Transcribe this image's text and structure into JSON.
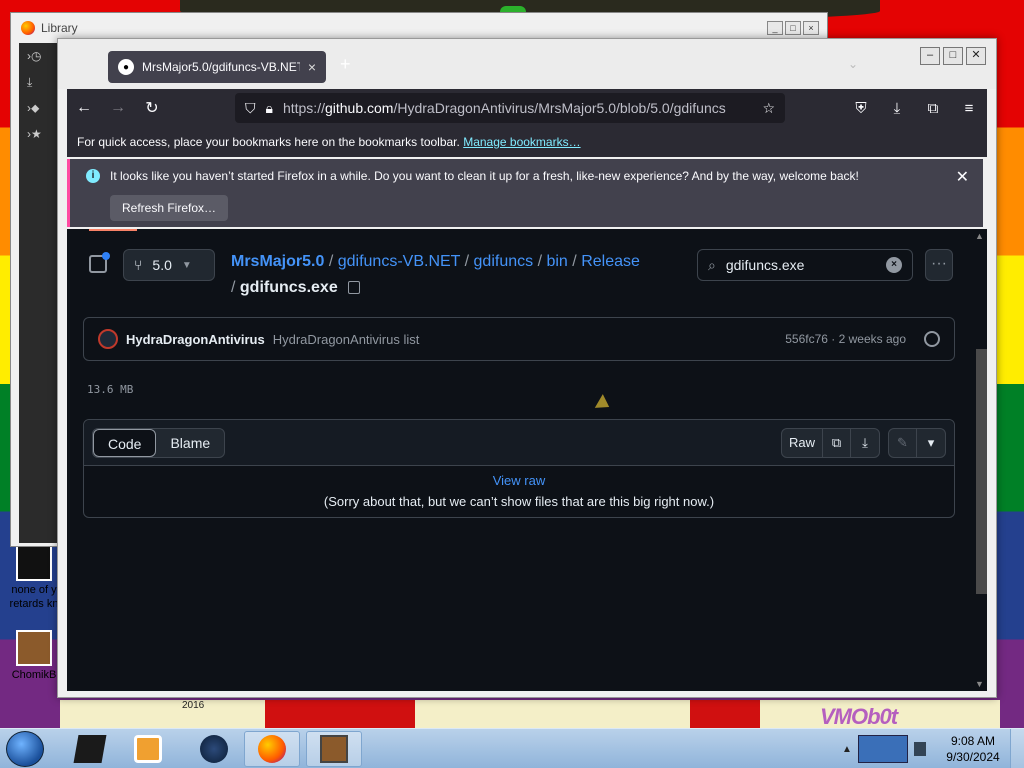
{
  "desktop": {
    "icons": [
      {
        "label": "none of y retards kn"
      },
      {
        "label": "ChomikB"
      }
    ],
    "wallpaper_year": "2016",
    "watermark": "VMOb0t"
  },
  "library_window": {
    "title": "Library"
  },
  "firefox": {
    "tab": {
      "title": "MrsMajor5.0/gdifuncs-VB.NET/",
      "close": "×"
    },
    "new_tab": "+",
    "urlbar": {
      "prefix": "https://",
      "host": "github.com",
      "path": "/HydraDragonAntivirus/MrsMajor5.0/blob/5.0/gdifuncs"
    },
    "bookmarks_bar": {
      "text": "For quick access, place your bookmarks here on the bookmarks toolbar.",
      "link": "Manage bookmarks…"
    },
    "notice": {
      "message": "It looks like you haven’t started Firefox in a while. Do you want to clean it up for a fresh, like-new experience? And by the way, welcome back!",
      "button": "Refresh Firefox…"
    }
  },
  "github": {
    "branch": "5.0",
    "breadcrumb": {
      "repo_owner": "MrsMajor5.0",
      "repo": "gdifuncs-VB.NET",
      "dir1": "gdifuncs",
      "dir2": "bin",
      "dir3": "Release",
      "file": "gdifuncs.exe",
      "sep": "/"
    },
    "search": {
      "value": "gdifuncs.exe"
    },
    "more": "···",
    "commit": {
      "author": "HydraDragonAntivirus",
      "message": "HydraDragonAntivirus list",
      "sha_time": "556fc76 · 2 weeks ago"
    },
    "file_size": "13.6 MB",
    "fileview": {
      "tabs": [
        "Code",
        "Blame"
      ],
      "active_tab": "Code",
      "raw_button": "Raw",
      "view_raw": "View raw",
      "too_big": "(Sorry about that, but we can’t show files that are this big right now.)"
    }
  },
  "taskbar": {
    "clock_time": "9:08 AM",
    "clock_date": "9/30/2024"
  }
}
